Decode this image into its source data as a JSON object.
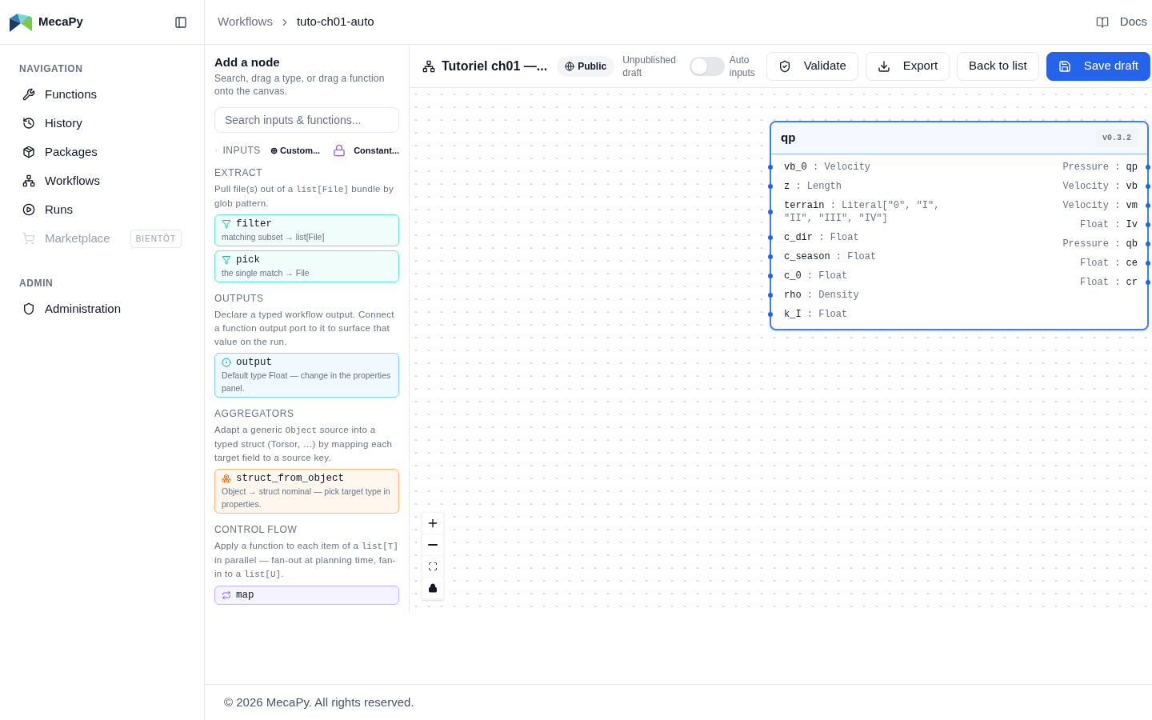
{
  "sidebar": {
    "brand": "MecaPy",
    "sections": [
      {
        "title": "NAVIGATION",
        "items": [
          {
            "label": "Functions",
            "disabled": false
          },
          {
            "label": "History",
            "disabled": false
          },
          {
            "label": "Packages",
            "disabled": false
          },
          {
            "label": "Workflows",
            "disabled": false
          },
          {
            "label": "Runs",
            "disabled": false
          },
          {
            "label": "Marketplace",
            "disabled": true,
            "badge": "BIENTÔT"
          }
        ]
      },
      {
        "title": "ADMIN",
        "items": [
          {
            "label": "Administration",
            "disabled": false
          }
        ]
      }
    ]
  },
  "header": {
    "breadcrumb": [
      "Workflows",
      "tuto-ch01-auto"
    ],
    "docs": "Docs"
  },
  "palette": {
    "title": "Add a node",
    "description": "Search, drag a type, or drag a function onto the canvas.",
    "search": {
      "placeholder": "Search inputs & functions..."
    },
    "inputs": {
      "title": "INPUTS",
      "expanded": false,
      "items": [
        "⊕ Custom...",
        "Constant..."
      ]
    },
    "sections": [
      {
        "kind": "extract",
        "title": "EXTRACT",
        "description": [
          {
            "text": "Pull file(s) out of a ",
            "code": false
          },
          {
            "text": "list[File]",
            "code": true
          },
          {
            "text": " bundle by glob pattern.",
            "code": false
          }
        ],
        "cards": [
          {
            "title": "filter",
            "subtitle": "matching subset → list[File]"
          },
          {
            "title": "pick",
            "subtitle": "the single match → File"
          }
        ]
      },
      {
        "kind": "output",
        "title": "OUTPUTS",
        "description": [
          {
            "text": "Declare a typed workflow output. Connect a function output port to it to surface that value on the run.",
            "code": false
          }
        ],
        "cards": [
          {
            "title": "output",
            "subtitle": "Default type Float — change in the properties panel."
          }
        ]
      },
      {
        "kind": "aggregator",
        "title": "AGGREGATORS",
        "description": [
          {
            "text": "Adapt a generic ",
            "code": false
          },
          {
            "text": "Object",
            "code": true
          },
          {
            "text": " source into a typed struct (Torsor, …) by mapping each target field to a source key.",
            "code": false
          }
        ],
        "cards": [
          {
            "title": "struct_from_object",
            "subtitle": "Object → struct nominal — pick target type in properties."
          }
        ]
      },
      {
        "kind": "control",
        "title": "CONTROL FLOW",
        "description": [
          {
            "text": "Apply a function to each item of a ",
            "code": false
          },
          {
            "text": "list[T]",
            "code": true
          },
          {
            "text": " in parallel — fan-out at planning time, fan-in to a ",
            "code": false
          },
          {
            "text": "list[U]",
            "code": true
          },
          {
            "text": ".",
            "code": false
          }
        ],
        "cards": [
          {
            "title": "map"
          }
        ]
      }
    ]
  },
  "toolbar": {
    "title": "Tutoriel ch01 —...",
    "visibility": "Public",
    "status": "Unpublished draft",
    "auto_inputs": {
      "label": "Auto inputs",
      "on": false
    },
    "buttons": [
      {
        "label": "Validate",
        "kind": "outline"
      },
      {
        "label": "Export",
        "kind": "outline"
      },
      {
        "label": "Back to list",
        "kind": "outline"
      },
      {
        "label": "Save draft",
        "kind": "primary"
      }
    ]
  },
  "canvas": {
    "node": {
      "title": "qp",
      "version": "v0.3.2",
      "selected": true,
      "inputs": [
        {
          "name": "vb_0",
          "separator": ":",
          "type": "Velocity"
        },
        {
          "name": "z",
          "separator": ":",
          "type": "Length"
        },
        {
          "name": "terrain",
          "separator": ":",
          "type": "Literal[\"0\", \"I\", \"II\", \"III\", \"IV\"]"
        },
        {
          "name": "c_dir",
          "separator": ":",
          "type": "Float"
        },
        {
          "name": "c_season",
          "separator": ":",
          "type": "Float"
        },
        {
          "name": "c_0",
          "separator": ":",
          "type": "Float"
        },
        {
          "name": "rho",
          "separator": ":",
          "type": "Density"
        },
        {
          "name": "k_I",
          "separator": ":",
          "type": "Float"
        }
      ],
      "outputs": [
        {
          "type": "Pressure",
          "separator": ":",
          "name": "qp"
        },
        {
          "type": "Velocity",
          "separator": ":",
          "name": "vb"
        },
        {
          "type": "Velocity",
          "separator": ":",
          "name": "vm"
        },
        {
          "type": "Float",
          "separator": ":",
          "name": "Iv"
        },
        {
          "type": "Pressure",
          "separator": ":",
          "name": "qb"
        },
        {
          "type": "Float",
          "separator": ":",
          "name": "ce"
        },
        {
          "type": "Float",
          "separator": ":",
          "name": "cr"
        }
      ]
    }
  },
  "footer": "© 2026 MecaPy. All rights reserved."
}
